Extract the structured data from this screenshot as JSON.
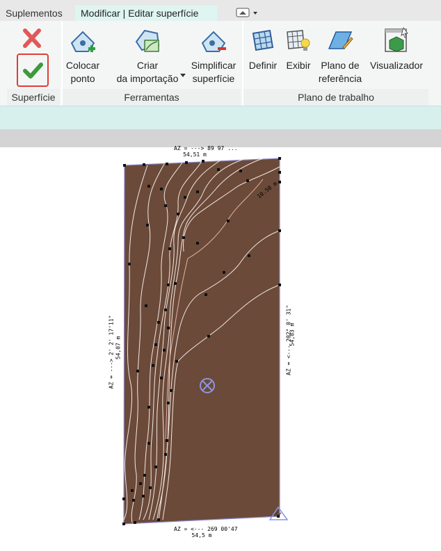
{
  "tabs": [
    {
      "label": "Suplementos"
    },
    {
      "label": "Modificar | Editar superfície"
    }
  ],
  "ribbon": {
    "tools": {
      "cancel": {
        "icon": "cancel-x-icon"
      },
      "finish": {
        "icon": "finish-check-icon"
      },
      "place_point": {
        "line1": "Colocar",
        "line2": "ponto",
        "icon": "place-point-icon"
      },
      "create_from_import": {
        "line1": "Criar",
        "line2": "da importação",
        "icon": "create-from-import-icon"
      },
      "simplify_surface": {
        "line1": "Simplificar",
        "line2": "superfície",
        "icon": "simplify-surface-icon"
      },
      "set": {
        "label": "Definir",
        "icon": "set-workplane-icon"
      },
      "show": {
        "label": "Exibir",
        "icon": "show-workplane-icon"
      },
      "ref_plane": {
        "line1": "Plano de",
        "line2": "referência",
        "icon": "reference-plane-icon"
      },
      "viewer": {
        "label": "Visualizador",
        "icon": "viewer-icon"
      }
    },
    "groups": {
      "surface": "Superfície",
      "tools": "Ferramentas",
      "workplane": "Plano de trabalho"
    }
  },
  "canvas": {
    "dims": {
      "top_bearing": "AZ = ---> 89 97 ...",
      "top_length": "54,51 m",
      "left_bearing": "AZ = ---> 2' 2' 17'11\"",
      "left_length": "54,07 m",
      "right_bearing": "AZ = <--- 202° 0' 31\"",
      "right_length": "54,03 m",
      "bottom_bearing": "AZ = <--- 269 00'47",
      "bottom_length": "54,5 m",
      "contour_label": "10.50 m"
    },
    "colors": {
      "toposurface_fill": "#6b4a3a",
      "contour_line": "#f4e9e2",
      "highlight_contour": "#e3b3a4",
      "boundary": "#8a86c8",
      "project_base_marker": "#8c95e0"
    }
  }
}
